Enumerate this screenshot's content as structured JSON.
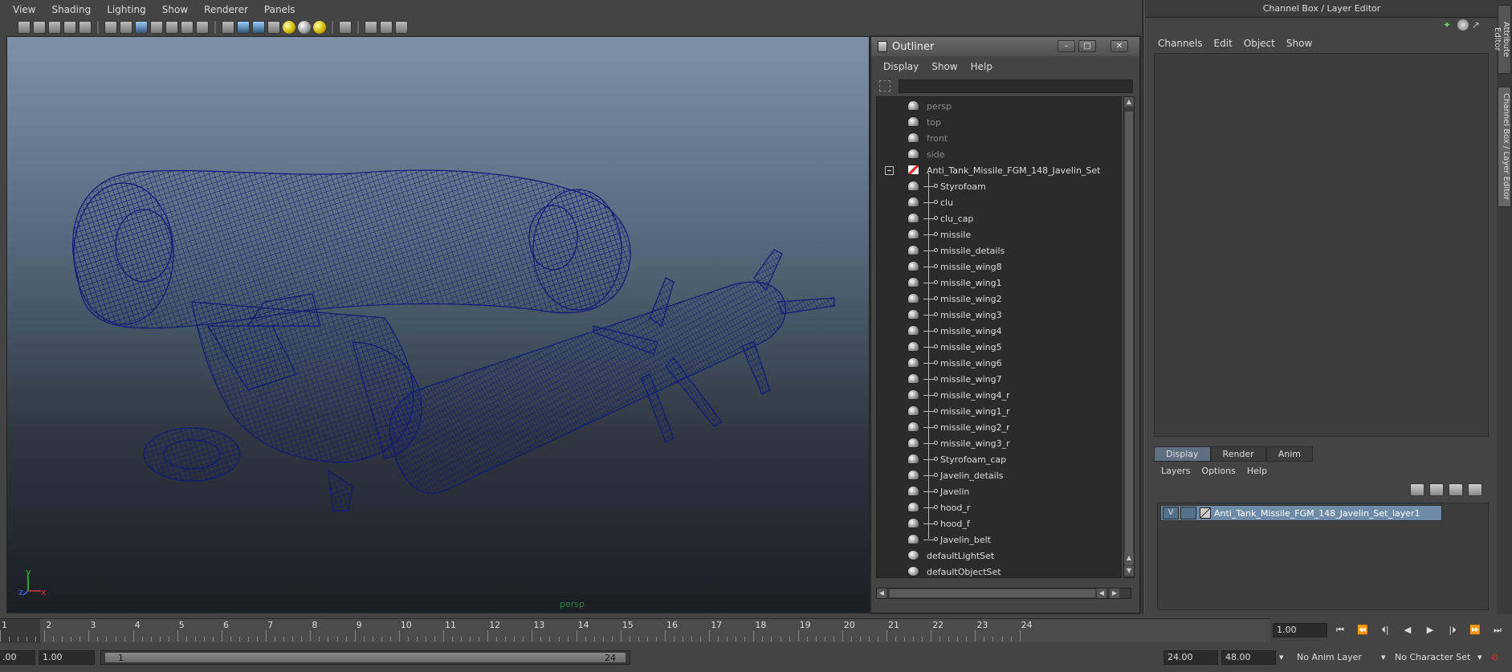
{
  "viewport": {
    "menu": [
      "View",
      "Shading",
      "Lighting",
      "Show",
      "Renderer",
      "Panels"
    ],
    "camera_label": "persp",
    "axis_labels": {
      "y": "y",
      "x": "x",
      "z": "z"
    },
    "wire_color": "#101a78"
  },
  "outliner": {
    "title": "Outliner",
    "menu": [
      "Display",
      "Show",
      "Help"
    ],
    "filter_value": "",
    "cameras": [
      "persp",
      "top",
      "front",
      "side"
    ],
    "group": "Anti_Tank_Missile_FGM_148_Javelin_Set",
    "children": [
      "Styrofoam",
      "clu",
      "clu_cap",
      "missile",
      "missile_details",
      "missile_wing8",
      "missile_wing1",
      "missile_wing2",
      "missile_wing3",
      "missile_wing4",
      "missile_wing5",
      "missile_wing6",
      "missile_wing7",
      "missile_wing4_r",
      "missile_wing1_r",
      "missile_wing2_r",
      "missile_wing3_r",
      "Styrofoam_cap",
      "Javelin_details",
      "Javelin",
      "hood_r",
      "hood_f",
      "Javelin_belt"
    ],
    "sets": [
      "defaultLightSet",
      "defaultObjectSet"
    ]
  },
  "channel_box": {
    "title": "Channel Box / Layer Editor",
    "menu": [
      "Channels",
      "Edit",
      "Object",
      "Show"
    ],
    "side_tabs": [
      "Attribute Editor",
      "Channel Box / Layer Editor"
    ]
  },
  "layer_editor": {
    "tabs": [
      "Display",
      "Render",
      "Anim"
    ],
    "active_tab": "Display",
    "menu": [
      "Layers",
      "Options",
      "Help"
    ],
    "layer": {
      "visible": "V",
      "name": "Anti_Tank_Missile_FGM_148_Javelin_Set_layer1"
    }
  },
  "timeline": {
    "ticks": [
      "1",
      "2",
      "3",
      "4",
      "5",
      "6",
      "7",
      "8",
      "9",
      "10",
      "11",
      "12",
      "13",
      "14",
      "15",
      "16",
      "17",
      "18",
      "19",
      "20",
      "21",
      "22",
      "23",
      "24"
    ],
    "current_frame": "1.00",
    "play_buttons": [
      "⏮",
      "⏪",
      "⏴|",
      "◀",
      "▶",
      "|⏵",
      "⏩",
      "⏭"
    ]
  },
  "range": {
    "start_frame": "1.00",
    "range_start": "1",
    "range_end": "24",
    "end_frame": "24.00",
    "anim_end": "48.00",
    "anim_layer": "No Anim Layer",
    "character_set": "No Character Set",
    "left_value": ".00"
  }
}
